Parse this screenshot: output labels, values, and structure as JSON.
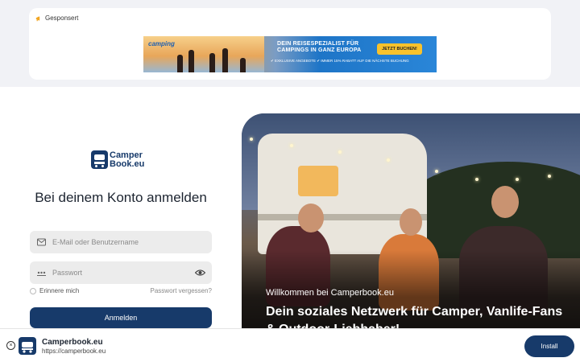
{
  "ad": {
    "label": "Gesponsert",
    "brand": "camping",
    "headline": "DEIN REISESPEZIALIST FÜR CAMPINGS IN GANZ EUROPA",
    "perks": "✔ EXKLUSIVE ANGEBOTE  ✔ IMMER 15% RABATT AUF DIE NÄCHSTE BUCHUNG",
    "cta": "JETZT BUCHEN!"
  },
  "logo": {
    "line1": "Camper",
    "line2": "Book.eu"
  },
  "login": {
    "title": "Bei deinem Konto anmelden",
    "email_placeholder": "E-Mail oder Benutzername",
    "password_placeholder": "Passwort",
    "remember_label": "Erinnere mich",
    "forgot_label": "Passwort vergessen?",
    "submit_label": "Anmelden"
  },
  "hero": {
    "welcome": "Willkommen bei Camperbook.eu",
    "tagline": "Dein soziales Netzwerk für Camper, Vanlife-Fans & Outdoor-Liebhaber!"
  },
  "install_bar": {
    "app_name": "Camperbook.eu",
    "url": "https://camperbook.eu",
    "install_label": "Install",
    "close_glyph": "×"
  },
  "colors": {
    "brand": "#173a6a",
    "background": "#f1f2f6",
    "ad_cta": "#f8c22c"
  }
}
